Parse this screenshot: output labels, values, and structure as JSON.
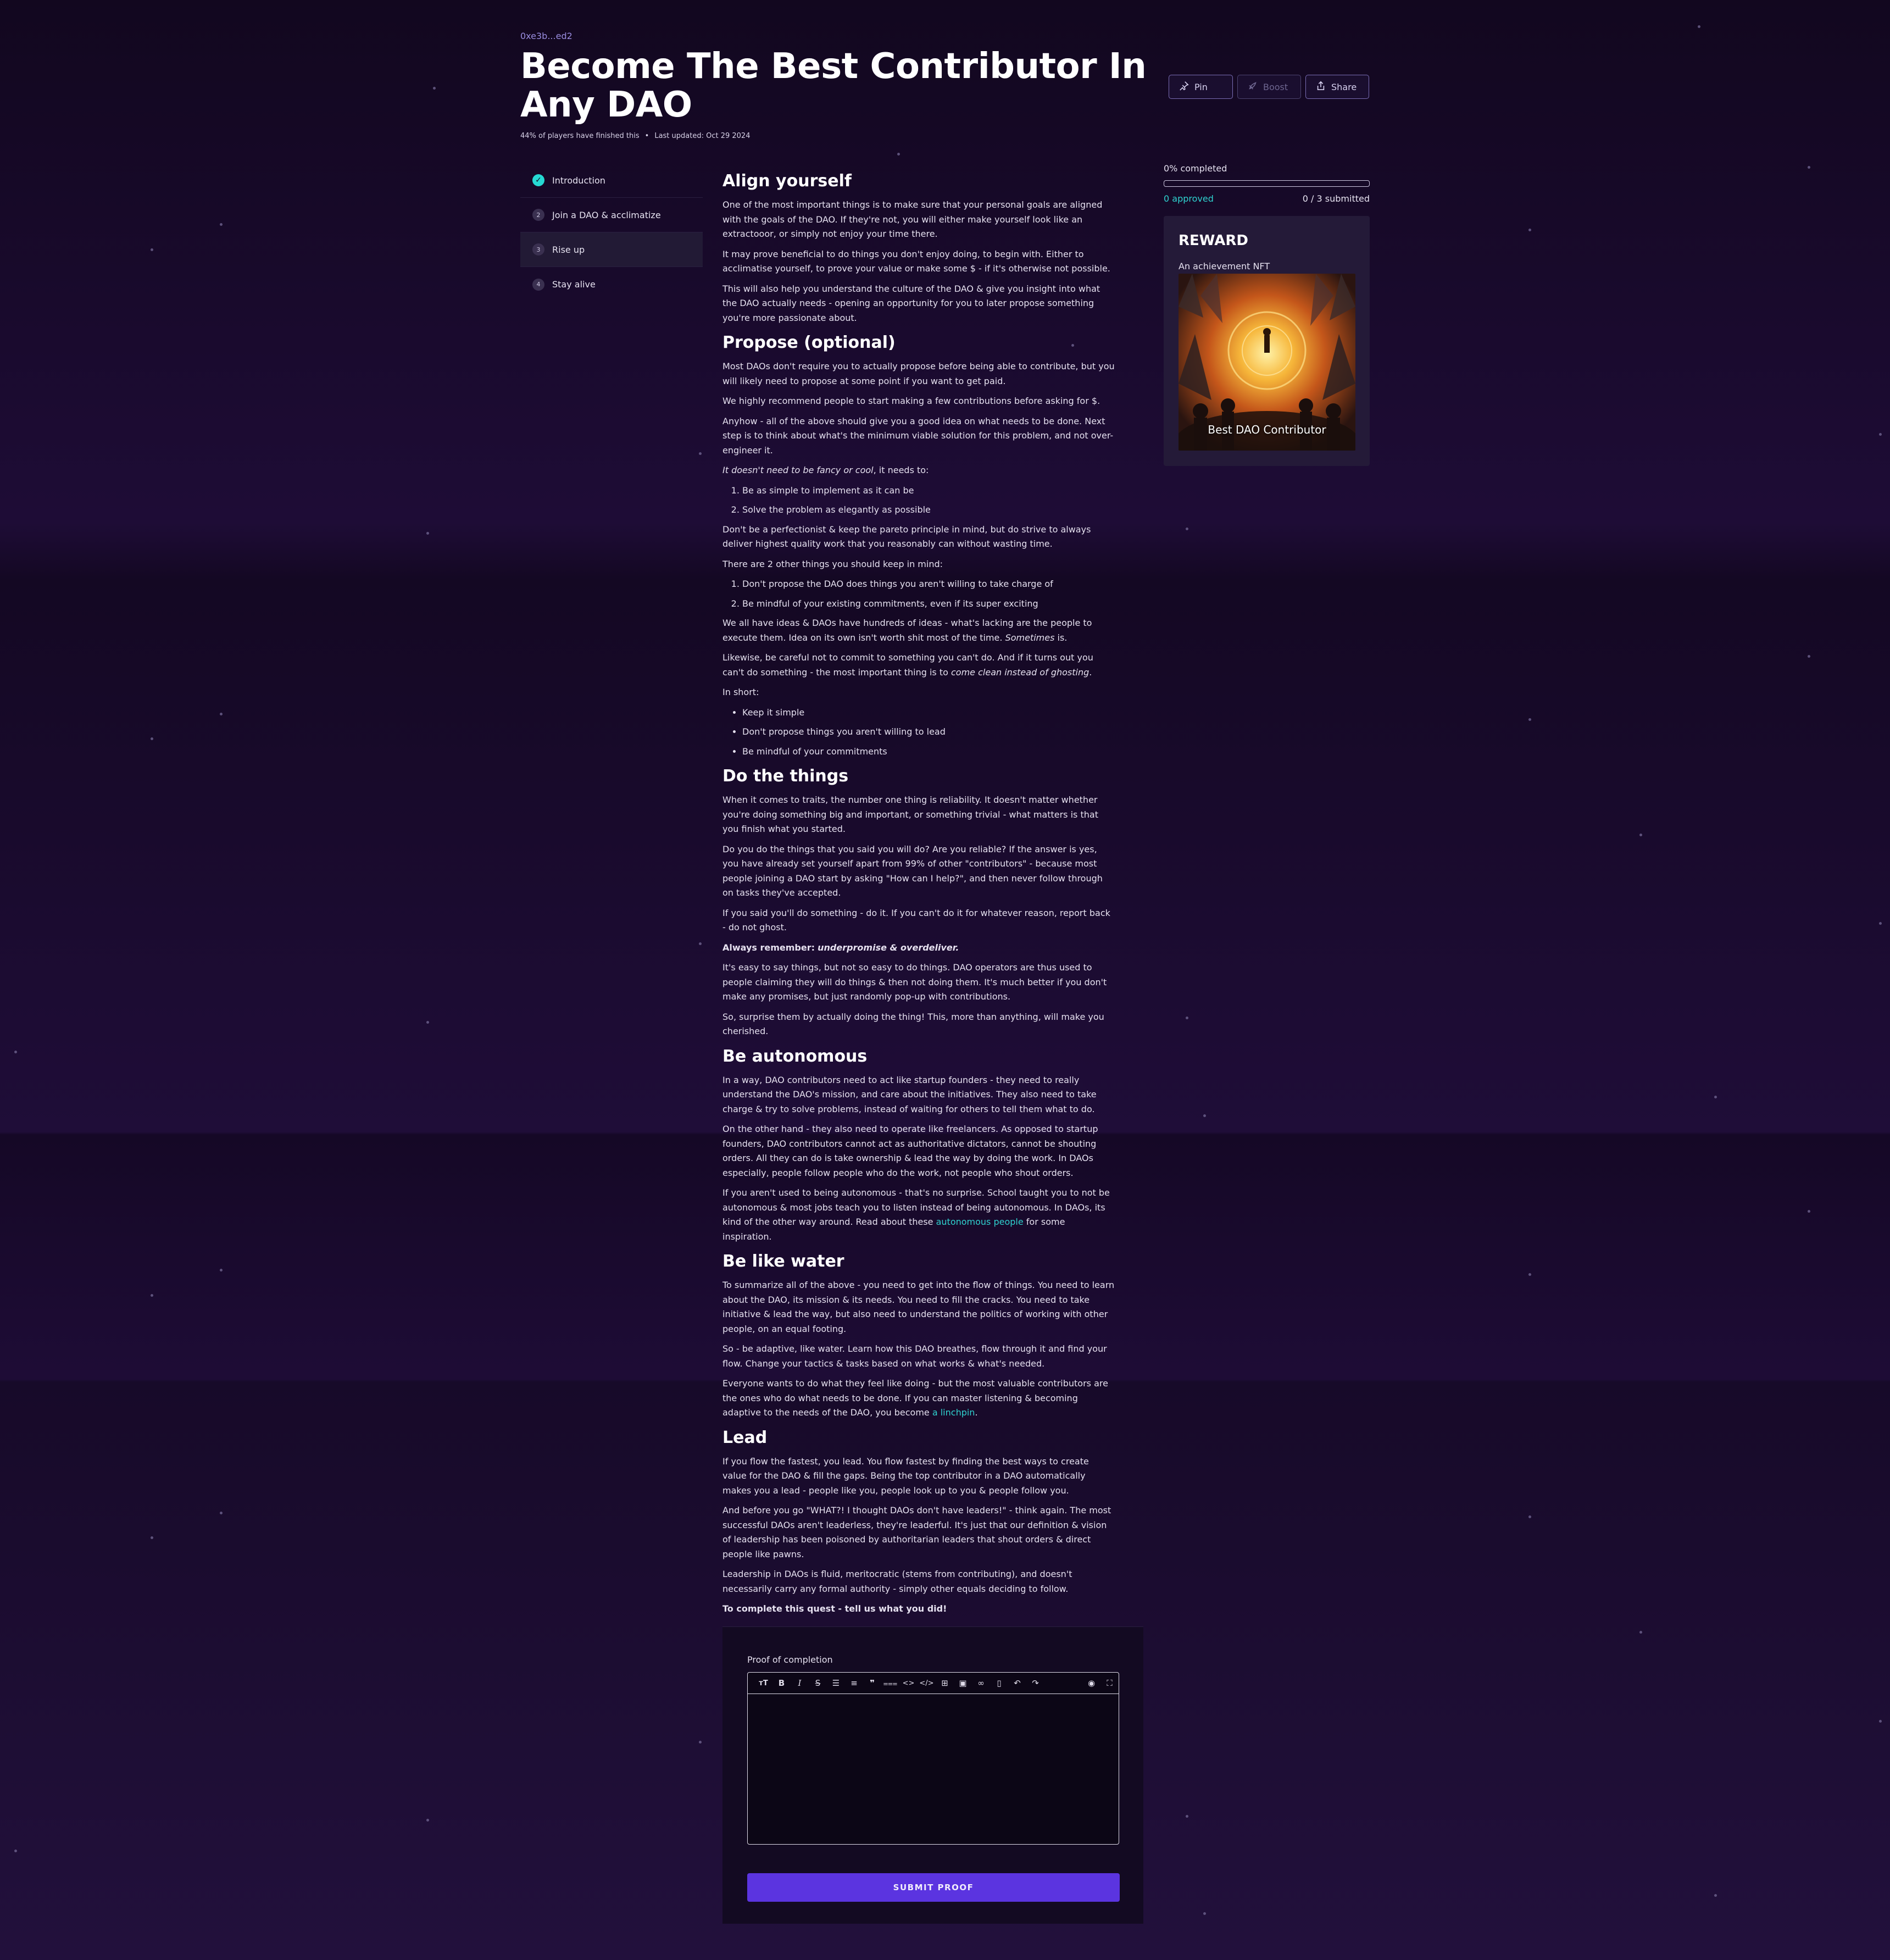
{
  "header": {
    "owner": "0xe3b...ed2",
    "title": "Become The Best Contributor In Any DAO",
    "players_finished": "44% of players have finished this",
    "last_updated": "Last updated: Oct 29 2024",
    "actions": {
      "pin": "Pin",
      "boost": "Boost",
      "share": "Share"
    }
  },
  "sidebar": {
    "items": [
      {
        "num": "✓",
        "label": "Introduction"
      },
      {
        "num": "2",
        "label": "Join a DAO & acclimatize"
      },
      {
        "num": "3",
        "label": "Rise up"
      },
      {
        "num": "4",
        "label": "Stay alive"
      }
    ]
  },
  "progress": {
    "label": "0% completed",
    "fraction": 0,
    "approved": "0 approved",
    "submitted": "0 / 3 submitted"
  },
  "reward": {
    "heading": "REWARD",
    "subtitle": "An achievement NFT",
    "nft_caption": "Best DAO Contributor"
  },
  "article": {
    "s1": {
      "heading": "Align yourself",
      "p1": "One of the most important things is to make sure that your personal goals are aligned with the goals of the DAO. If they're not, you will either make yourself look like an extractooor, or simply not enjoy your time there.",
      "p2": "It may prove beneficial to do things you don't enjoy doing, to begin with. Either to acclimatise yourself, to prove your value or make some $ - if it's otherwise not possible.",
      "p3": "This will also help you understand the culture of the DAO & give you insight into what the DAO actually needs - opening an opportunity for you to later propose something you're more passionate about."
    },
    "s2": {
      "heading": "Propose (optional)",
      "p1": "Most DAOs don't require you to actually propose before being able to contribute, but you will likely need to propose at some point if you want to get paid.",
      "p2": "We highly recommend people to start making a few contributions before asking for $.",
      "p3": "Anyhow - all of the above should give you a good idea on what needs to be done. Next step is to think about what's the minimum viable solution for this problem, and not over-engineer it.",
      "p4_em": "It doesn't need to be fancy or cool",
      "p4_rest": ", it needs to:",
      "ol1": [
        "Be as simple to implement as it can be",
        "Solve the problem as elegantly as possible"
      ],
      "p5": "Don't be a perfectionist & keep the pareto principle in mind, but do strive to always deliver highest quality work that you reasonably can without wasting time.",
      "p6": "There are 2 other things you should keep in mind:",
      "ol2": [
        "Don't propose the DAO does things you aren't willing to take charge of",
        "Be mindful of your existing commitments, even if its super exciting"
      ],
      "p7_a": "We all have ideas & DAOs have hundreds of ideas - what's lacking are the people to execute them. Idea on its own isn't worth shit most of the time. ",
      "p7_em": "Sometimes",
      "p7_b": " is.",
      "p8_a": "Likewise, be careful not to commit to something you can't do. And if it turns out you can't do something - the most important thing is to ",
      "p8_em": "come clean instead of ghosting",
      "p8_b": ".",
      "p9": "In short:",
      "ul": [
        "Keep it simple",
        "Don't propose things you aren't willing to lead",
        "Be mindful of your commitments"
      ]
    },
    "s3": {
      "heading": "Do the things",
      "p1": "When it comes to traits, the number one thing is reliability. It doesn't matter whether you're doing something big and important, or something trivial - what matters is that you finish what you started.",
      "p2": "Do you do the things that you said you will do? Are you reliable? If the answer is yes, you have already set yourself apart from 99% of other \"contributors\" - because most people joining a DAO start by asking \"How can I help?\", and then never follow through on tasks they've accepted.",
      "p3": "If you said you'll do something - do it. If you can't do it for whatever reason, report back - do not ghost.",
      "p4_b": "Always remember:",
      "p4_em": "underpromise & overdeliver.",
      "p5": "It's easy to say things, but not so easy to do things. DAO operators are thus used to people claiming they will do things & then not doing them. It's much better if you don't make any promises, but just randomly pop-up with contributions.",
      "p6": "So, surprise them by actually doing the thing! This, more than anything, will make you cherished."
    },
    "s4": {
      "heading": "Be autonomous",
      "p1": "In a way, DAO contributors need to act like startup founders - they need to really understand the DAO's mission, and care about the initiatives. They also need to take charge & try to solve problems, instead of waiting for others to tell them what to do.",
      "p2": "On the other hand - they also need to operate like freelancers. As opposed to startup founders, DAO contributors cannot act as authoritative dictators, cannot be shouting orders. All they can do is take ownership & lead the way by doing the work. In DAOs especially, people follow people who do the work, not people who shout orders.",
      "p3_a": "If you aren't used to being autonomous - that's no surprise. School taught you to not be autonomous & most jobs teach you to listen instead of being autonomous. In DAOs, its kind of the other way around. Read about these ",
      "p3_link": "autonomous people",
      "p3_b": " for some inspiration."
    },
    "s5": {
      "heading": "Be like water",
      "p1": "To summarize all of the above - you need to get into the flow of things. You need to learn about the DAO, its mission & its needs. You need to fill the cracks. You need to take initiative & lead the way, but also need to understand the politics of working with other people, on an equal footing.",
      "p2": "So - be adaptive, like water. Learn how this DAO breathes, flow through it and find your flow. Change your tactics & tasks based on what works & what's needed.",
      "p3_a": "Everyone wants to do what they feel like doing - but the most valuable contributors are the ones who do what needs to be done. If you can master listening & becoming adaptive to the needs of the DAO, you become ",
      "p3_link": "a linchpin",
      "p3_b": "."
    },
    "s6": {
      "heading": "Lead",
      "p1": "If you flow the fastest, you lead. You flow fastest by finding the best ways to create value for the DAO & fill the gaps. Being the top contributor in a DAO automatically makes you a lead - people like you, people look up to you & people follow you.",
      "p2": "And before you go \"WHAT?! I thought DAOs don't have leaders!\" - think again. The most successful DAOs aren't leaderless, they're leaderful. It's just that our definition & vision of leadership has been poisoned by authoritarian leaders that shout orders & direct people like pawns.",
      "p3": "Leadership in DAOs is fluid, meritocratic (stems from contributing), and doesn't necessarily carry any formal authority - simply other equals deciding to follow.",
      "p4": "To complete this quest - tell us what you did!"
    }
  },
  "proof": {
    "label": "Proof of completion",
    "toolbar": [
      "heading-icon",
      "bold-icon",
      "italic-icon",
      "strikethrough-icon",
      "bullet-list-icon",
      "ordered-list-icon",
      "quote-icon",
      "horizontal-rule-icon",
      "code-icon",
      "code-block-icon",
      "table-icon",
      "image-icon",
      "link-icon",
      "clipboard-icon",
      "undo-icon",
      "redo-icon",
      "preview-icon",
      "fullscreen-icon"
    ],
    "submit": "SUBMIT PROOF"
  },
  "colors": {
    "accent": "#5b34e0",
    "link": "#2fd3d0",
    "background": "#1e0c36"
  }
}
